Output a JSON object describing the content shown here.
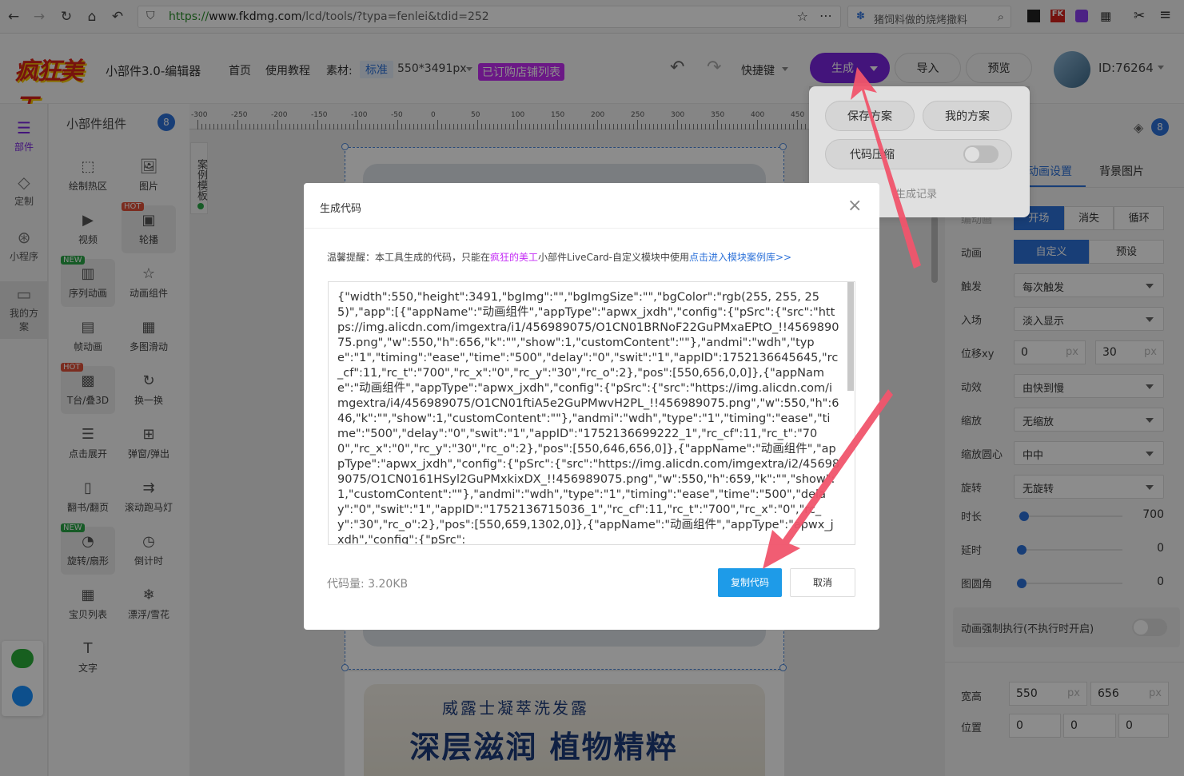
{
  "browser": {
    "url_scheme": "https://",
    "url_host": "www.fkdmg.com",
    "url_path": "/lcd/tools/?typa=fenlei&tdid=252",
    "search_text": "猪饲料做的烧烤撒料"
  },
  "header": {
    "app_title": "小部件3.0-编辑器",
    "nav_home": "首页",
    "nav_tutorial": "使用教程",
    "material_label": "素材:",
    "material_type": "标准",
    "material_size": "550*3491px",
    "store_list": "已订购店铺列表",
    "shortcuts": "快捷键",
    "generate": "生成",
    "import": "导入",
    "preview": "预览",
    "user_id": "ID:76264"
  },
  "rail": {
    "items": [
      "部件",
      "定制",
      "小程序",
      "我的方案"
    ]
  },
  "components": {
    "title": "小部件组件",
    "count": "8",
    "items": [
      "绘制热区",
      "图片",
      "视频",
      "轮播",
      "序列动画",
      "动画组件",
      "帧动画",
      "多图滑动",
      "T台/叠3D",
      "换一换",
      "点击展开",
      "弹窗/弹出",
      "翻书/翻页",
      "滚动跑马灯",
      "旋转/扇形",
      "倒计时",
      "宝贝列表",
      "漂浮/雪花",
      "文字"
    ],
    "tags": {
      "hot": "HOT",
      "new": "NEW"
    }
  },
  "ruler": {
    "ticks": [
      "-300",
      "-250",
      "-200",
      "-150",
      "-100",
      "-50",
      "0",
      "50",
      "100",
      "150",
      "200",
      "250",
      "300",
      "350",
      "400",
      "450"
    ]
  },
  "case_template": "案例模板",
  "canvas": {
    "product_subtitle": "威露士凝萃洗发露",
    "product_title": "深层滋润 植物精粹"
  },
  "dropdown": {
    "save_plan": "保存方案",
    "my_plans": "我的方案",
    "code_compress": "代码压缩",
    "history": "生成记录"
  },
  "right_panel": {
    "layer_count": "8",
    "tabs": [
      "动画设置",
      "背景图片"
    ],
    "rows": [
      {
        "label": "编动画",
        "options": [
          "开场",
          "消失",
          "循环"
        ]
      },
      {
        "label": "动画",
        "options": [
          "自定义",
          "预设"
        ]
      },
      {
        "label": "触发",
        "value": "每次触发"
      },
      {
        "label": "入场",
        "value": "淡入显示"
      },
      {
        "label": "位移xy",
        "x": "0",
        "y": "30",
        "unit": "px"
      },
      {
        "label": "动效",
        "value": "由快到慢"
      },
      {
        "label": "缩放",
        "value": "无缩放"
      },
      {
        "label": "缩放圆心",
        "value": "中中"
      },
      {
        "label": "旋转",
        "value": "无旋转"
      }
    ],
    "sliders": [
      {
        "label": "时长",
        "value": "700",
        "fraction": 0.02
      },
      {
        "label": "延时",
        "value": "0",
        "fraction": 0
      },
      {
        "label": "图圆角",
        "value": "0",
        "fraction": 0
      }
    ],
    "force_run": "动画强制执行(不执行时开启)",
    "size_label": "宽高",
    "width": "550",
    "height": "656",
    "unit": "px",
    "pos_label": "位置",
    "pos": [
      "0",
      "0",
      "0"
    ]
  },
  "modal": {
    "title": "生成代码",
    "tip_prefix": "温馨提醒：本工具生成的代码，只能在",
    "tip_brand": "疯狂的美工",
    "tip_middle": "小部件LiveCard-自定义模块中使用",
    "tip_link": "点击进入模块案例库>>",
    "code": "{\"width\":550,\"height\":3491,\"bgImg\":\"\",\"bgImgSize\":\"\",\"bgColor\":\"rgb(255, 255, 255)\",\"app\":[{\"appName\":\"动画组件\",\"appType\":\"apwx_jxdh\",\"config\":{\"pSrc\":{\"src\":\"https://img.alicdn.com/imgextra/i1/456989075/O1CN01BRNoF22GuPMxaEPtO_!!456989075.png\",\"w\":550,\"h\":656,\"k\":\"\",\"show\":1,\"customContent\":\"\"},\"andmi\":\"wdh\",\"type\":\"1\",\"timing\":\"ease\",\"time\":\"500\",\"delay\":\"0\",\"swit\":\"1\",\"appID\":1752136645645,\"rc_cf\":11,\"rc_t\":\"700\",\"rc_x\":\"0\",\"rc_y\":\"30\",\"rc_o\":2},\"pos\":[550,656,0,0]},{\"appName\":\"动画组件\",\"appType\":\"apwx_jxdh\",\"config\":{\"pSrc\":{\"src\":\"https://img.alicdn.com/imgextra/i4/456989075/O1CN01ftiA5e2GuPMwvH2PL_!!456989075.png\",\"w\":550,\"h\":646,\"k\":\"\",\"show\":1,\"customContent\":\"\"},\"andmi\":\"wdh\",\"type\":\"1\",\"timing\":\"ease\",\"time\":\"500\",\"delay\":\"0\",\"swit\":\"1\",\"appID\":\"1752136699222_1\",\"rc_cf\":11,\"rc_t\":\"700\",\"rc_x\":\"0\",\"rc_y\":\"30\",\"rc_o\":2},\"pos\":[550,646,656,0]},{\"appName\":\"动画组件\",\"appType\":\"apwx_jxdh\",\"config\":{\"pSrc\":{\"src\":\"https://img.alicdn.com/imgextra/i2/456989075/O1CN0161HSyl2GuPMxkixDX_!!456989075.png\",\"w\":550,\"h\":659,\"k\":\"\",\"show\":1,\"customContent\":\"\"},\"andmi\":\"wdh\",\"type\":\"1\",\"timing\":\"ease\",\"time\":\"500\",\"delay\":\"0\",\"swit\":\"1\",\"appID\":\"1752136715036_1\",\"rc_cf\":11,\"rc_t\":\"700\",\"rc_x\":\"0\",\"rc_y\":\"30\",\"rc_o\":2},\"pos\":[550,659,1302,0]},{\"appName\":\"动画组件\",\"appType\":\"apwx_jxdh\",\"config\":{\"pSrc\":",
    "size_label": "代码量:",
    "size_value": "3.20KB",
    "copy": "复制代码",
    "cancel": "取消"
  },
  "colors": {
    "purple": "#7b25e0",
    "blue": "#2d72d9",
    "modal_blue": "#1e9be8",
    "arrow": "#f0546c",
    "magenta": "#c42cf5"
  }
}
